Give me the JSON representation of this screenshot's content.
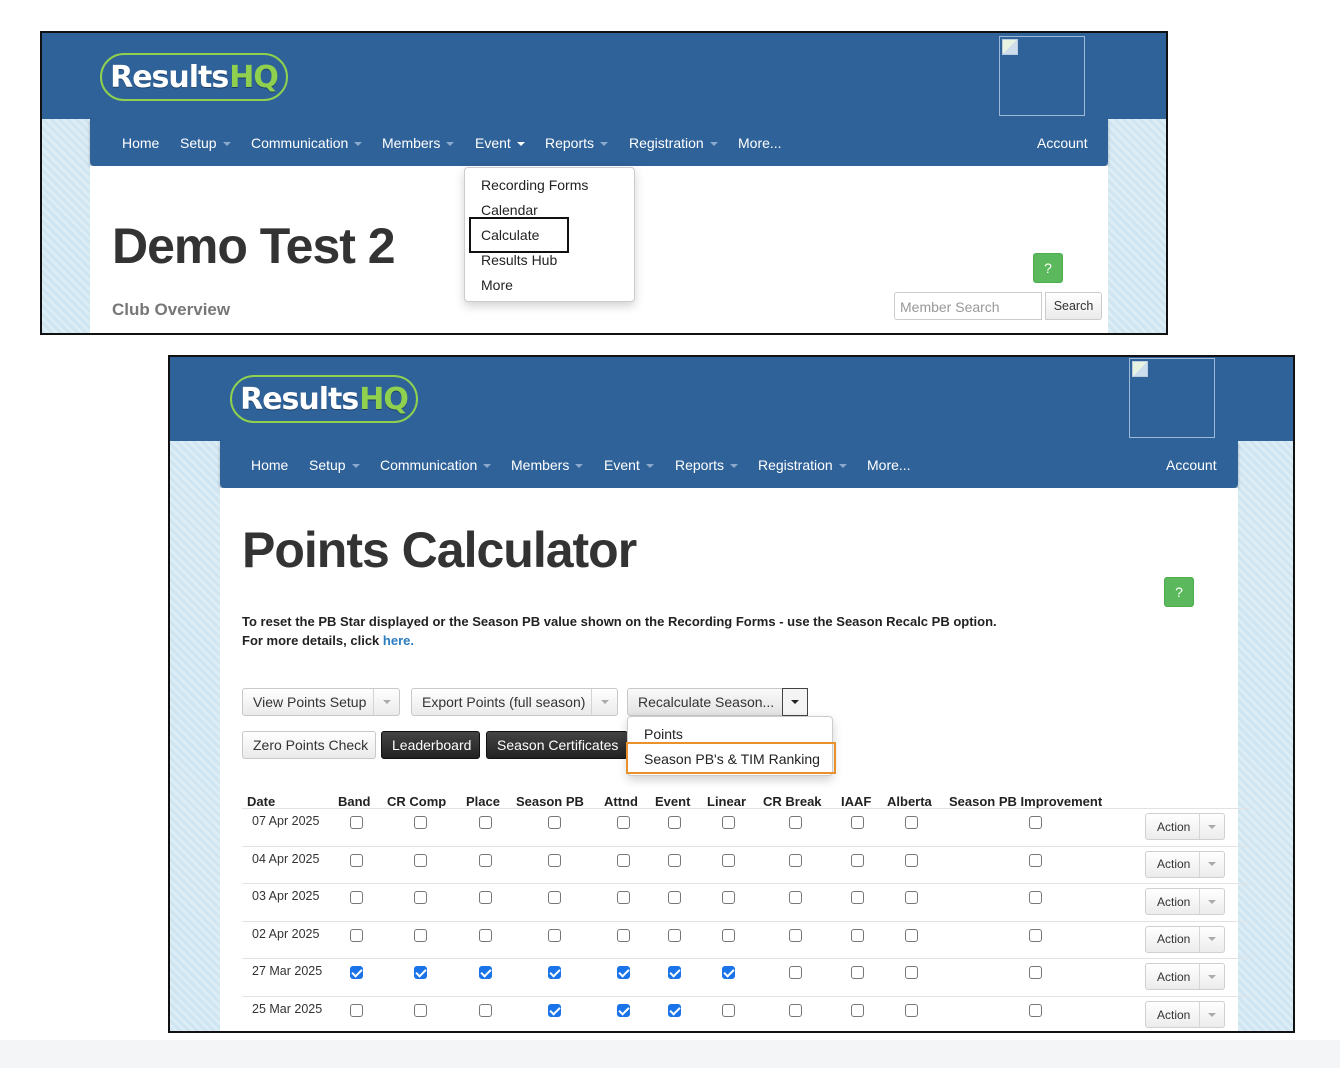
{
  "brand": {
    "logo_main": "Results",
    "logo_accent": "HQ"
  },
  "nav": {
    "items": [
      {
        "label": "Home"
      },
      {
        "label": "Setup"
      },
      {
        "label": "Communication"
      },
      {
        "label": "Members"
      },
      {
        "label": "Event"
      },
      {
        "label": "Reports"
      },
      {
        "label": "Registration"
      },
      {
        "label": "More..."
      }
    ],
    "account": "Account"
  },
  "screen1": {
    "title": "Demo Test 2",
    "subtitle": "Club Overview",
    "help": "?",
    "event_menu": [
      "Recording Forms",
      "Calendar",
      "Calculate",
      "Results Hub",
      "More"
    ],
    "highlighted_item": "Calculate",
    "search": {
      "placeholder": "Member Search",
      "button": "Search"
    }
  },
  "screen2": {
    "title": "Points Calculator",
    "help": "?",
    "info_line1": "To reset the PB Star displayed or the Season PB value shown on the Recording Forms - use the Season Recalc PB option.",
    "info_line2": "For more details, click",
    "info_link": "here.",
    "buttons": {
      "view_points": "View Points Setup",
      "export_points": "Export Points (full season)",
      "recalculate": "Recalculate Season...",
      "zero_points": "Zero Points Check",
      "leaderboard": "Leaderboard",
      "certificates": "Season Certificates"
    },
    "recalc_menu": [
      "Points",
      "Season PB's & TIM Ranking"
    ],
    "highlighted_item": "Season PB's & TIM Ranking",
    "columns": [
      "Date",
      "Band",
      "CR Comp",
      "Place",
      "Season PB",
      "Attnd",
      "Event",
      "Linear",
      "CR Break",
      "IAAF",
      "Alberta",
      "Season PB Improvement"
    ],
    "action_label": "Action",
    "rows": [
      {
        "date": "07 Apr 2025",
        "checks": [
          false,
          false,
          false,
          false,
          false,
          false,
          false,
          false,
          false,
          false,
          false
        ]
      },
      {
        "date": "04 Apr 2025",
        "checks": [
          false,
          false,
          false,
          false,
          false,
          false,
          false,
          false,
          false,
          false,
          false
        ]
      },
      {
        "date": "03 Apr 2025",
        "checks": [
          false,
          false,
          false,
          false,
          false,
          false,
          false,
          false,
          false,
          false,
          false
        ]
      },
      {
        "date": "02 Apr 2025",
        "checks": [
          false,
          false,
          false,
          false,
          false,
          false,
          false,
          false,
          false,
          false,
          false
        ]
      },
      {
        "date": "27 Mar 2025",
        "checks": [
          true,
          true,
          true,
          true,
          true,
          true,
          true,
          false,
          false,
          false,
          false
        ]
      },
      {
        "date": "25 Mar 2025",
        "checks": [
          false,
          false,
          false,
          true,
          true,
          true,
          false,
          false,
          false,
          false,
          false
        ]
      }
    ]
  }
}
